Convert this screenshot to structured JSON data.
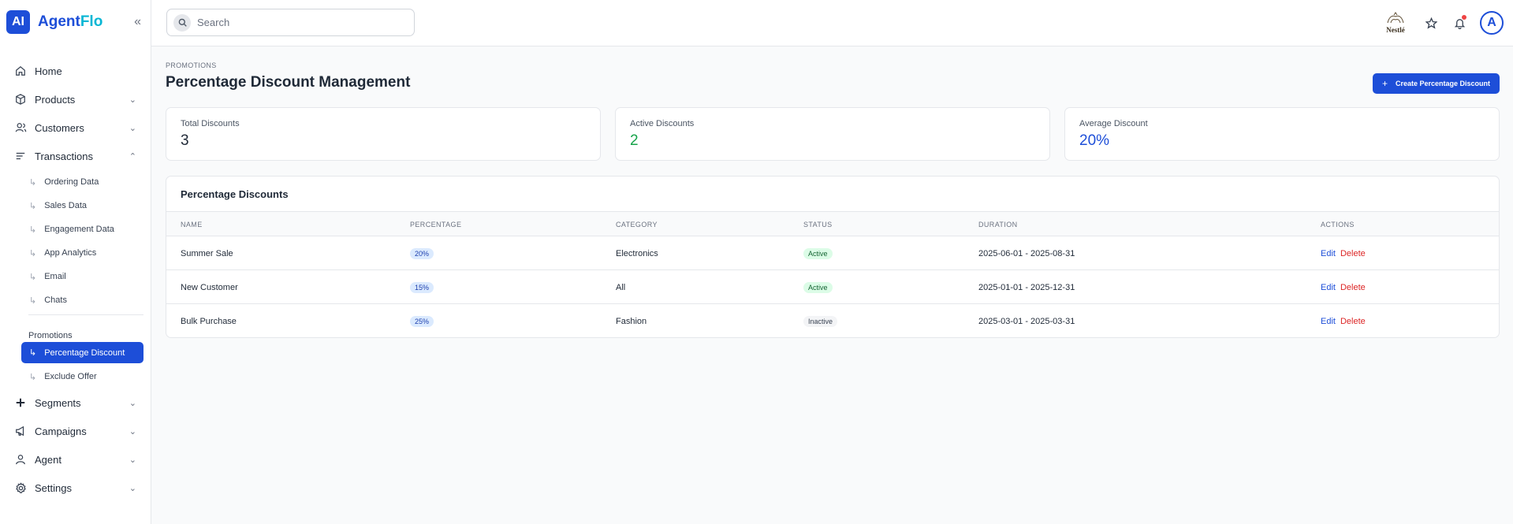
{
  "brand": {
    "logo": "AI",
    "name_part1": "Agent",
    "name_part2": "Flo"
  },
  "sidebar": {
    "items": [
      {
        "label": "Home",
        "icon": "home-icon"
      },
      {
        "label": "Products",
        "icon": "box-icon"
      },
      {
        "label": "Customers",
        "icon": "users-icon"
      },
      {
        "label": "Transactions",
        "icon": "list-icon"
      }
    ],
    "transactions_sub": [
      "Ordering Data",
      "Sales Data",
      "Engagement Data",
      "App Analytics",
      "Email",
      "Chats"
    ],
    "promotions_label": "Promotions",
    "promotions_sub": [
      "Percentage Discount",
      "Exclude Offer"
    ],
    "bottom_items": [
      {
        "label": "Segments",
        "icon": "plus-icon"
      },
      {
        "label": "Campaigns",
        "icon": "megaphone-icon"
      },
      {
        "label": "Agent",
        "icon": "user-icon"
      },
      {
        "label": "Settings",
        "icon": "gear-icon"
      }
    ]
  },
  "search": {
    "placeholder": "Search"
  },
  "header": {
    "client_logo_text": "Nestlé",
    "avatar_letter": "A"
  },
  "page": {
    "breadcrumb": "PROMOTIONS",
    "title": "Percentage Discount Management",
    "create_label": "Create Percentage Discount"
  },
  "stats": [
    {
      "label": "Total Discounts",
      "value": "3",
      "color": "#1f2937"
    },
    {
      "label": "Active Discounts",
      "value": "2",
      "color": "#16a34a"
    },
    {
      "label": "Average Discount",
      "value": "20%",
      "color": "#1d4ed8"
    }
  ],
  "table": {
    "title": "Percentage Discounts",
    "columns": [
      "NAME",
      "PERCENTAGE",
      "CATEGORY",
      "STATUS",
      "DURATION",
      "ACTIONS"
    ],
    "rows": [
      {
        "name": "Summer Sale",
        "percentage": "20%",
        "category": "Electronics",
        "status": "Active",
        "duration": "2025-06-01 - 2025-08-31"
      },
      {
        "name": "New Customer",
        "percentage": "15%",
        "category": "All",
        "status": "Active",
        "duration": "2025-01-01 - 2025-12-31"
      },
      {
        "name": "Bulk Purchase",
        "percentage": "25%",
        "category": "Fashion",
        "status": "Inactive",
        "duration": "2025-03-01 - 2025-03-31"
      }
    ],
    "edit_label": "Edit",
    "delete_label": "Delete"
  }
}
